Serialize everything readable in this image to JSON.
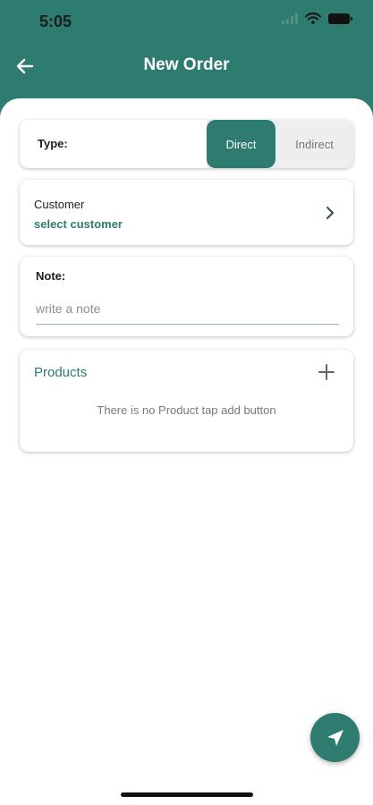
{
  "status_bar": {
    "time": "5:05"
  },
  "header": {
    "title": "New Order"
  },
  "type_selector": {
    "label": "Type:",
    "options": [
      "Direct",
      "Indirect"
    ],
    "selected": "Direct"
  },
  "customer": {
    "label": "Customer",
    "value": "select customer"
  },
  "note": {
    "label": "Note:",
    "placeholder": "write a note",
    "value": ""
  },
  "products": {
    "label": "Products",
    "empty_message": "There is no Product tap add button"
  },
  "icons": {
    "back": "arrow-left-icon",
    "chevron": "chevron-right-icon",
    "add": "plus-icon",
    "send": "navigation-arrow-icon"
  },
  "colors": {
    "primary": "#2e7b6f",
    "background": "#ffffff",
    "segment_inactive": "#eeeeee"
  }
}
